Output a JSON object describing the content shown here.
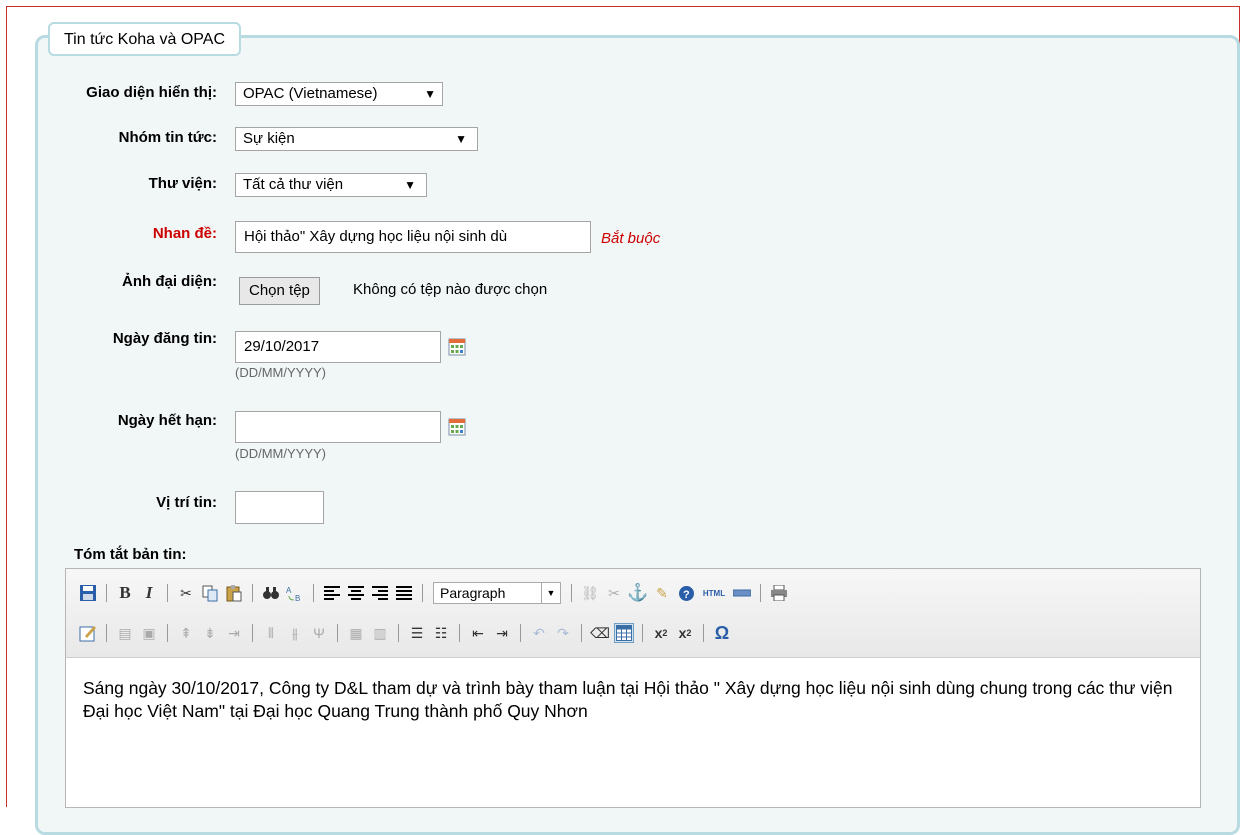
{
  "legend": "Tin tức Koha và OPAC",
  "form": {
    "display_label": "Giao diện hiển thị:",
    "display_value": "OPAC (Vietnamese)",
    "group_label": "Nhóm tin tức:",
    "group_value": "Sự kiện",
    "library_label": "Thư viện:",
    "library_value": "Tất cả thư viện",
    "title_label": "Nhan đề:",
    "title_value": "Hội thảo\" Xây dựng học liệu nội sinh dù",
    "required_note": "Bắt buộc",
    "image_label": "Ảnh đại diện:",
    "file_button": "Chọn tệp",
    "file_status": "Không có tệp nào được chọn",
    "publish_label": "Ngày đăng tin:",
    "publish_value": "29/10/2017",
    "publish_hint": "(DD/MM/YYYY)",
    "expiry_label": "Ngày hết hạn:",
    "expiry_value": "",
    "expiry_hint": "(DD/MM/YYYY)",
    "position_label": "Vị trí tin:",
    "position_value": "",
    "summary_label": "Tóm tắt bản tin:"
  },
  "editor": {
    "format_select": "Paragraph",
    "content": "Sáng ngày 30/10/2017, Công ty D&L tham dự và trình bày tham luận tại Hội thảo \" Xây dựng học liệu nội sinh dùng chung trong các thư viện Đại học Việt Nam\" tại Đại học Quang Trung thành phố Quy Nhơn"
  },
  "colors": {
    "required": "#cc0000",
    "fieldset_border": "#b7dbe1",
    "fieldset_bg": "#f1f6f7",
    "page_border": "#c9302c"
  }
}
